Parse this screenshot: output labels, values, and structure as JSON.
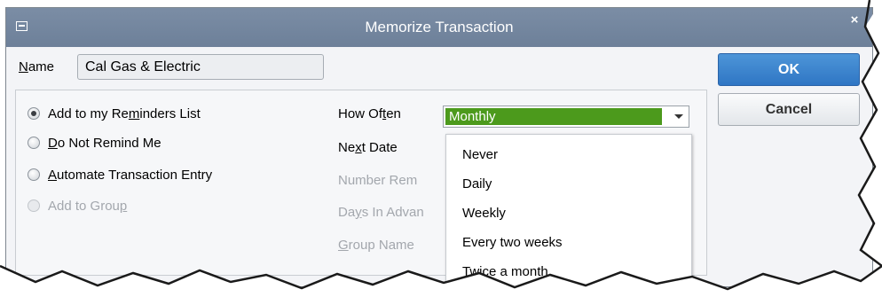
{
  "window": {
    "title": "Memorize Transaction",
    "close_glyph": "×"
  },
  "name": {
    "label_underlined": "N",
    "label_rest": "ame",
    "value": "Cal Gas & Electric"
  },
  "buttons": {
    "ok": "OK",
    "cancel": "Cancel"
  },
  "options": {
    "add_reminders": {
      "pre": "Add to my Re",
      "ul": "m",
      "post": "inders List",
      "checked": true
    },
    "do_not_remind": {
      "pre": "",
      "ul": "D",
      "post": "o Not Remind Me",
      "checked": false
    },
    "automate": {
      "pre": "",
      "ul": "A",
      "post": "utomate Transaction Entry",
      "checked": false
    },
    "add_group": {
      "pre": "Add to Grou",
      "ul": "p",
      "post": "",
      "checked": false,
      "disabled": true
    }
  },
  "fields": {
    "how_often": {
      "pre": "How Of",
      "ul": "t",
      "post": "en"
    },
    "next_date": {
      "pre": "Ne",
      "ul": "x",
      "post": "t Date"
    },
    "number_remaining": {
      "text": "Number Rem"
    },
    "days_in_advance": {
      "pre": "Da",
      "ul": "y",
      "post": "s In Advan"
    },
    "group_name": {
      "pre": "",
      "ul": "G",
      "post": "roup Name"
    }
  },
  "how_often_select": {
    "selected": "Monthly"
  },
  "frequency_options": [
    "Never",
    "Daily",
    "Weekly",
    "Every two weeks",
    "Twice a month"
  ],
  "colors": {
    "titlebar": "#6d8099",
    "selected_option": "#4c9a1c",
    "ok_button": "#2f76c4"
  },
  "icons": {
    "system_menu": "window-menu-icon",
    "close": "close-icon",
    "dropdown_arrow": "chevron-down-icon"
  }
}
